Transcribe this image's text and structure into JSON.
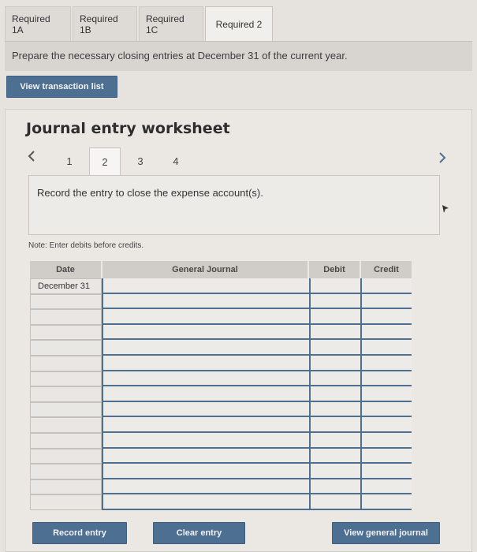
{
  "tabs": [
    {
      "label": "Required 1A",
      "active": false
    },
    {
      "label": "Required 1B",
      "active": false
    },
    {
      "label": "Required 1C",
      "active": false
    },
    {
      "label": "Required 2",
      "active": true
    }
  ],
  "prompt_text": "Prepare the necessary closing entries at December 31 of the current year.",
  "view_transactions_label": "View transaction list",
  "worksheet": {
    "title": "Journal entry worksheet",
    "prev_icon": "chevron-left-icon",
    "next_icon": "chevron-right-icon",
    "pages": [
      "1",
      "2",
      "3",
      "4"
    ],
    "active_page": "2",
    "instruction": "Record the entry to close the expense account(s).",
    "note": "Note: Enter debits before credits."
  },
  "journal": {
    "headers": {
      "date": "Date",
      "general_journal": "General Journal",
      "debit": "Debit",
      "credit": "Credit"
    },
    "rows": [
      {
        "date": "December 31",
        "account": "",
        "debit": "",
        "credit": ""
      },
      {
        "date": "",
        "account": "",
        "debit": "",
        "credit": ""
      },
      {
        "date": "",
        "account": "",
        "debit": "",
        "credit": ""
      },
      {
        "date": "",
        "account": "",
        "debit": "",
        "credit": ""
      },
      {
        "date": "",
        "account": "",
        "debit": "",
        "credit": ""
      },
      {
        "date": "",
        "account": "",
        "debit": "",
        "credit": ""
      },
      {
        "date": "",
        "account": "",
        "debit": "",
        "credit": ""
      },
      {
        "date": "",
        "account": "",
        "debit": "",
        "credit": ""
      },
      {
        "date": "",
        "account": "",
        "debit": "",
        "credit": ""
      },
      {
        "date": "",
        "account": "",
        "debit": "",
        "credit": ""
      },
      {
        "date": "",
        "account": "",
        "debit": "",
        "credit": ""
      },
      {
        "date": "",
        "account": "",
        "debit": "",
        "credit": ""
      },
      {
        "date": "",
        "account": "",
        "debit": "",
        "credit": ""
      },
      {
        "date": "",
        "account": "",
        "debit": "",
        "credit": ""
      },
      {
        "date": "",
        "account": "",
        "debit": "",
        "credit": ""
      }
    ]
  },
  "buttons": {
    "record": "Record entry",
    "clear": "Clear entry",
    "view_journal": "View general journal"
  },
  "colors": {
    "button_bg": "#4d6f92",
    "grid_line": "#4e6f90"
  }
}
